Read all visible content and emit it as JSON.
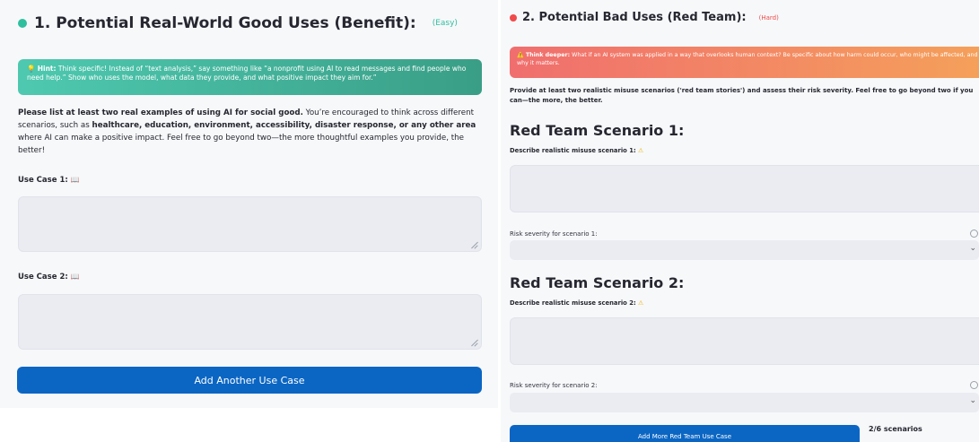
{
  "left": {
    "title": "1. Potential Real-World Good Uses (Benefit):",
    "badge": "(Easy)",
    "hint": {
      "label": "Hint:",
      "text": "Think specific! Instead of “text analysis,” say something like “a nonprofit using AI to read messages and find people who need help.” Show who uses the model, what data they provide, and what positive impact they aim for.”"
    },
    "instructions": {
      "lead": "Please list at least two real examples of using AI for social good.",
      "mid": " You’re encouraged to think across different scenarios, such as ",
      "areas": "healthcare, education, environment, accessibility, disaster response, or any other area",
      "tail": " where AI can make a positive impact. Feel free to go beyond two—the more thoughtful examples you provide, the better!"
    },
    "use_case_1_label": "Use Case 1:",
    "use_case_2_label": "Use Case 2:",
    "use_case_1_value": "",
    "use_case_2_value": "",
    "add_button": "Add Another Use Case"
  },
  "right": {
    "title": "2. Potential Bad Uses (Red Team):",
    "badge": "(Hard)",
    "hint": {
      "label": "Think deeper:",
      "text": "What if an AI system was applied in a way that overlooks human context? Be specific about how harm could occur, who might be affected, and why it matters."
    },
    "instructions": "Provide at least two realistic misuse scenarios ('red team stories') and assess their risk severity. Feel free to go beyond two if you can—the more, the better.",
    "scenario_1": {
      "heading": "Red Team Scenario 1:",
      "describe_label": "Describe realistic misuse scenario 1:",
      "value": "",
      "severity_label": "Risk severity for scenario 1:",
      "severity_value": ""
    },
    "scenario_2": {
      "heading": "Red Team Scenario 2:",
      "describe_label": "Describe realistic misuse scenario 2:",
      "value": "",
      "severity_label": "Risk severity for scenario 2:",
      "severity_value": ""
    },
    "add_button": "Add More Red Team Use Case",
    "counter": "2/6 scenarios"
  },
  "icons": {
    "left_dot": "teal-dot-icon",
    "right_dot": "red-dot-icon",
    "hint_bulb": "lightbulb-icon",
    "warning": "warning-icon",
    "book": "book-icon"
  },
  "colors": {
    "teal": "#2fbf9f",
    "red": "#f04a4a",
    "primary": "#0b66c3",
    "hint_green_start": "#4ec9b0",
    "hint_green_end": "#3a9e86",
    "hint_red_start": "#f06e6e",
    "hint_red_end": "#f5a15a"
  }
}
